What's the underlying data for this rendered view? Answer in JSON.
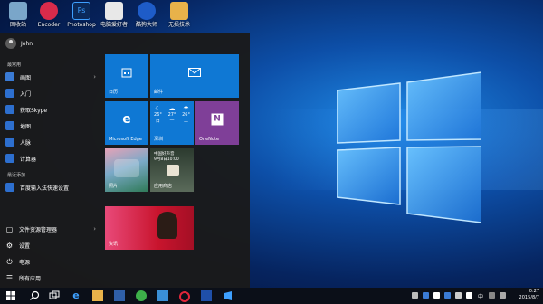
{
  "desktop": {
    "icons": [
      {
        "label": "回收站",
        "icon": "recycle-bin-icon",
        "color": "#7aa6c9"
      },
      {
        "label": "Encoder",
        "icon": "encoder-icon",
        "color": "#d92b4b"
      },
      {
        "label": "Photoshop",
        "icon": "photoshop-icon",
        "color": "#0b2a5a"
      },
      {
        "label": "电脑爱好者",
        "icon": "book-icon",
        "color": "#e8e8e8"
      },
      {
        "label": "酷狗大师",
        "icon": "kugou-icon",
        "color": "#1e5cc8"
      },
      {
        "label": "无损技术",
        "icon": "folder-icon",
        "color": "#e8b24a"
      }
    ]
  },
  "start_menu": {
    "user_name": "John",
    "most_used_title": "最常用",
    "most_used": [
      {
        "label": "画图",
        "icon": "paint-icon",
        "color": "#3a7bd5",
        "has_arrow": true
      },
      {
        "label": "入门",
        "icon": "lightbulb-icon",
        "color": "#2d6fcf",
        "has_arrow": false
      },
      {
        "label": "获取Skype",
        "icon": "skype-icon",
        "color": "#2d6fcf",
        "has_arrow": false
      },
      {
        "label": "地图",
        "icon": "map-icon",
        "color": "#2d6fcf",
        "has_arrow": false
      },
      {
        "label": "人脉",
        "icon": "people-icon",
        "color": "#2d6fcf",
        "has_arrow": false
      },
      {
        "label": "计算器",
        "icon": "calculator-icon",
        "color": "#2d6fcf",
        "has_arrow": false
      }
    ],
    "recently_added_title": "最近添加",
    "recently_added": [
      {
        "label": "百度输入法快速设置",
        "icon": "baidu-icon",
        "color": "#2d6fcf"
      }
    ],
    "bottom": [
      {
        "label": "文件资源管理器",
        "icon": "folder-icon",
        "glyph": "▢",
        "has_arrow": true
      },
      {
        "label": "设置",
        "icon": "gear-icon",
        "glyph": "⚙",
        "has_arrow": false
      },
      {
        "label": "电源",
        "icon": "power-icon",
        "glyph": "⏻",
        "has_arrow": false
      },
      {
        "label": "所有应用",
        "icon": "list-icon",
        "glyph": "☰",
        "has_arrow": false
      }
    ],
    "tiles": {
      "calendar": {
        "label": "日历",
        "color": "#0f78d4"
      },
      "mail": {
        "label": "邮件",
        "color": "#0f78d4"
      },
      "edge": {
        "label": "Microsoft Edge",
        "color": "#0f78d4"
      },
      "weather": {
        "label": "深圳",
        "color": "#0f78d4",
        "temps": [
          "26°",
          "27°",
          "26°"
        ],
        "days": [
          "日",
          "一",
          "二"
        ]
      },
      "onenote": {
        "label": "OneNote",
        "color": "#7f3f98"
      },
      "photos": {
        "label": "照片",
        "color": "#2a6a8a"
      },
      "store": {
        "label": "应用商店",
        "color": "#0f78d4",
        "headline": "中国好声音",
        "headline2": "9月8日10:00"
      },
      "news": {
        "label": "资讯",
        "color": "#c8142d"
      }
    }
  },
  "taskbar": {
    "items": [
      {
        "icon": "start-icon"
      },
      {
        "icon": "search-icon"
      },
      {
        "icon": "task-view-icon"
      },
      {
        "icon": "edge-icon"
      },
      {
        "icon": "explorer-icon"
      },
      {
        "icon": "store-icon"
      },
      {
        "icon": "wechat-icon"
      },
      {
        "icon": "photos-icon"
      },
      {
        "icon": "opera-icon"
      },
      {
        "icon": "app-icon"
      },
      {
        "icon": "windows-icon"
      }
    ],
    "ime": "中",
    "time": "0:27",
    "date": "2015/8/7"
  },
  "colors": {
    "accent": "#0f78d4",
    "start_bg": "#1a1a1a",
    "taskbar_bg": "#0b0f18"
  }
}
